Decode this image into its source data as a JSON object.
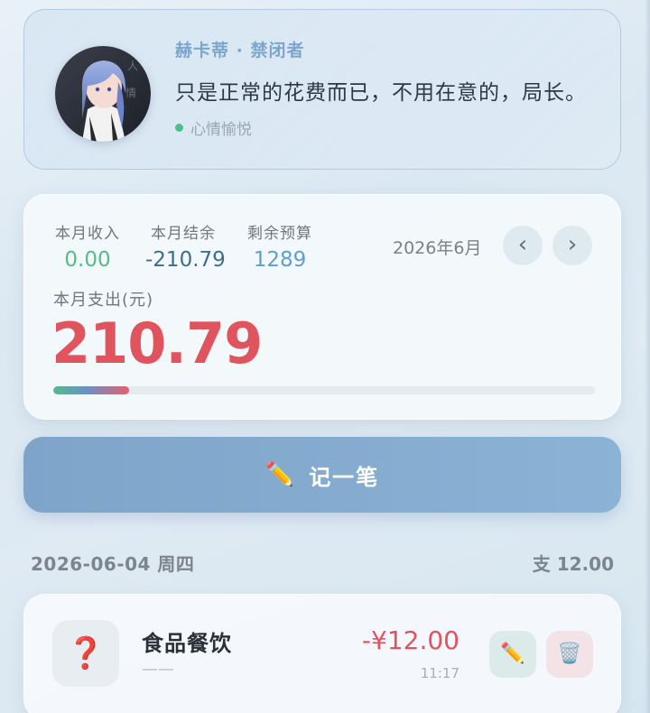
{
  "character": {
    "name": "赫卡蒂 · 禁闭者",
    "quote": "只是正常的花费而已，不用在意的，局长。",
    "mood": "心情愉悦"
  },
  "summary": {
    "income_label": "本月收入",
    "income_value": "0.00",
    "balance_label": "本月结余",
    "balance_value": "-210.79",
    "budget_label": "剩余预算",
    "budget_value": "1289",
    "month": "2026年6月",
    "prev_icon": "‹",
    "next_icon": "›",
    "expense_label": "本月支出(元)",
    "expense_value": "210.79",
    "budget_used_fraction": 0.14,
    "colors": {
      "income": "#5ab98a",
      "balance": "#3f6d8c",
      "budget": "#5f9fd0",
      "expense": "#e0545e"
    }
  },
  "record_button": {
    "icon": "✏️",
    "label": "记一笔"
  },
  "day_group": {
    "date": "2026-06-04 周四",
    "total": "支 12.00"
  },
  "transactions": [
    {
      "icon": "❓",
      "category": "食品餐饮",
      "note": "——",
      "amount": "-¥12.00",
      "time": "11:17",
      "edit_icon": "✏️",
      "delete_icon": "🗑️"
    }
  ]
}
